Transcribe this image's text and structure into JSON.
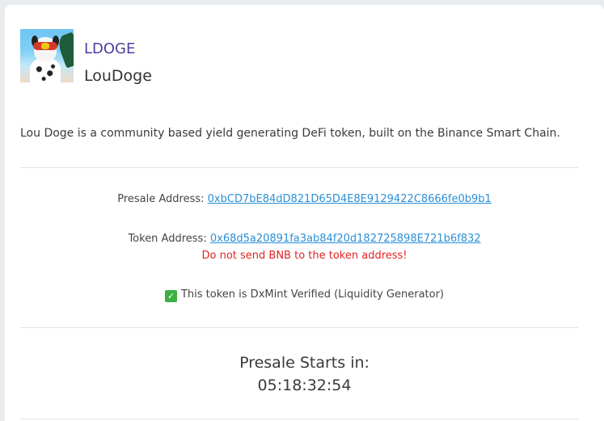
{
  "token": {
    "symbol": "LDOGE",
    "name": "LouDoge",
    "logo_icon": "loudoge-logo-icon",
    "description": "Lou Doge is a community based yield generating DeFi token, built on the Binance Smart Chain."
  },
  "presale": {
    "address_label": "Presale Address:",
    "address": "0xbCD7bE84dD821D65D4E8E9129422C8666fe0b9b1"
  },
  "token_address": {
    "label": "Token Address:",
    "address": "0x68d5a20891fa3ab84f20d182725898E721b6f832",
    "warning": "Do not send BNB to the token address!"
  },
  "verification": {
    "icon": "check-icon",
    "text": "This token is DxMint Verified (Liquidity Generator)"
  },
  "countdown": {
    "title": "Presale Starts in:",
    "value": "05:18:32:54"
  },
  "colors": {
    "symbol": "#4b3f9e",
    "link": "#2a8fd6",
    "warning": "#e02424",
    "verified": "#3cb043"
  }
}
